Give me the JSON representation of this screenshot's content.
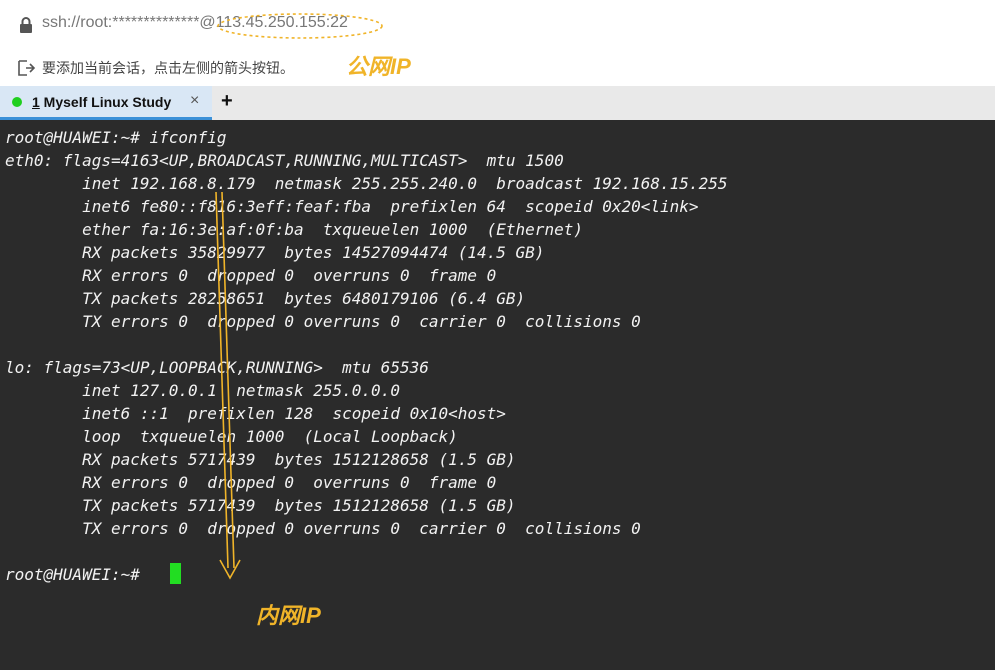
{
  "address_bar": {
    "url": "ssh://root:**************@113.45.250.155:22"
  },
  "hint_bar": {
    "text": "要添加当前会话，点击左侧的箭头按钮。"
  },
  "annotations": {
    "public_ip": "公网IP",
    "private_ip": "内网IP",
    "color": "#f0b429"
  },
  "tabs": [
    {
      "number": "1",
      "label": " Myself Linux Study",
      "close": "×",
      "status_color": "#1fcf1f"
    }
  ],
  "new_tab": "+",
  "terminal": {
    "lines": [
      "root@HUAWEI:~# ifconfig",
      "eth0: flags=4163<UP,BROADCAST,RUNNING,MULTICAST>  mtu 1500",
      "        inet 192.168.8.179  netmask 255.255.240.0  broadcast 192.168.15.255",
      "        inet6 fe80::f816:3eff:feaf:fba  prefixlen 64  scopeid 0x20<link>",
      "        ether fa:16:3e:af:0f:ba  txqueuelen 1000  (Ethernet)",
      "        RX packets 35829977  bytes 14527094474 (14.5 GB)",
      "        RX errors 0  dropped 0  overruns 0  frame 0",
      "        TX packets 28258651  bytes 6480179106 (6.4 GB)",
      "        TX errors 0  dropped 0 overruns 0  carrier 0  collisions 0",
      "",
      "lo: flags=73<UP,LOOPBACK,RUNNING>  mtu 65536",
      "        inet 127.0.0.1  netmask 255.0.0.0",
      "        inet6 ::1  prefixlen 128  scopeid 0x10<host>",
      "        loop  txqueuelen 1000  (Local Loopback)",
      "        RX packets 5717439  bytes 1512128658 (1.5 GB)",
      "        RX errors 0  dropped 0  overruns 0  frame 0",
      "        TX packets 5717439  bytes 1512128658 (1.5 GB)",
      "        TX errors 0  dropped 0 overruns 0  carrier 0  collisions 0",
      "",
      "root@HUAWEI:~# "
    ],
    "cursor_color": "#22dd22"
  }
}
